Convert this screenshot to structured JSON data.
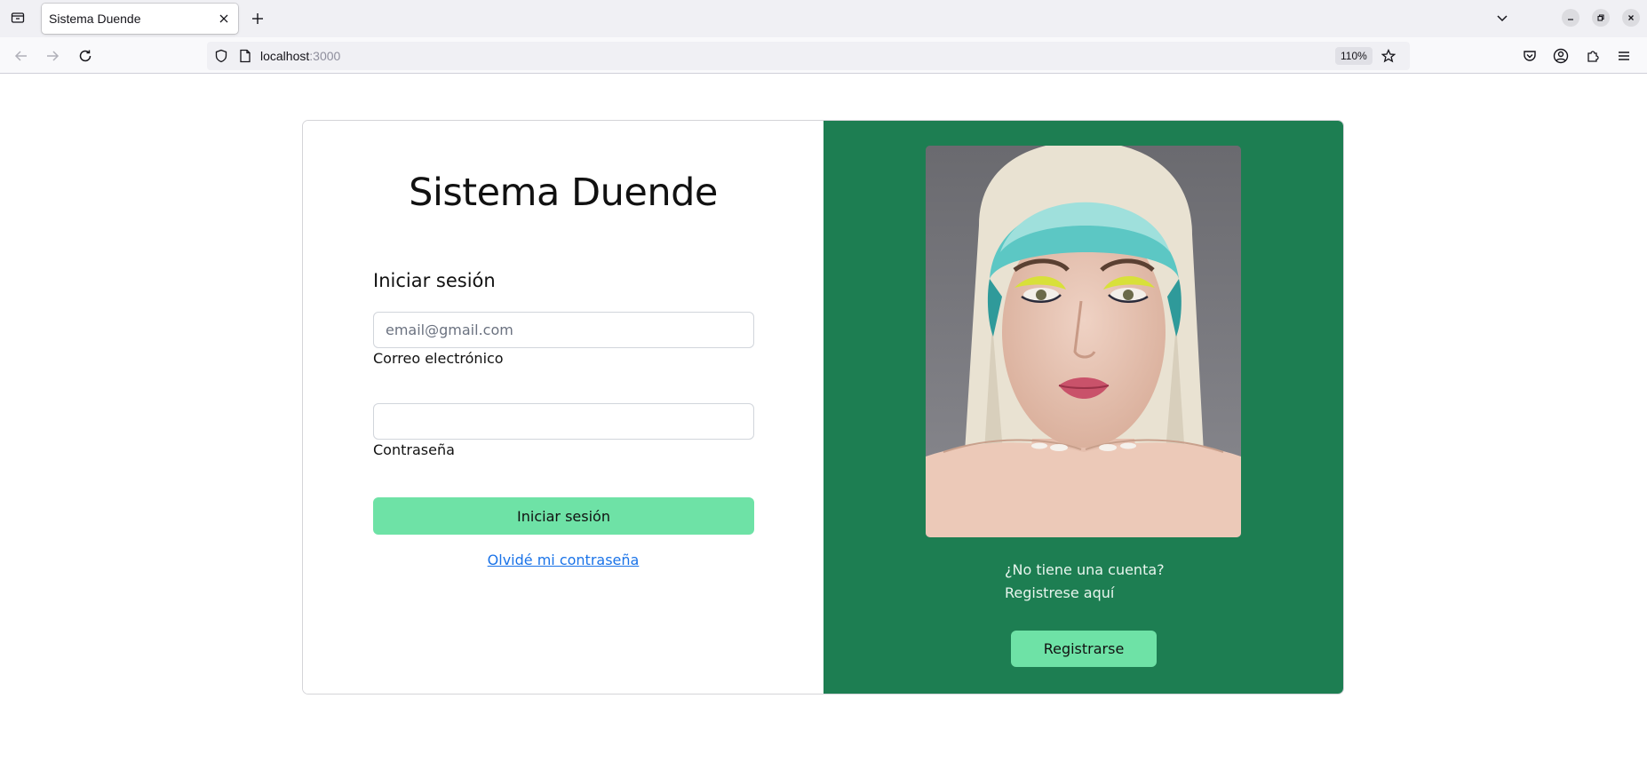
{
  "browser": {
    "tab_title": "Sistema Duende",
    "url_host": "localhost",
    "url_port": ":3000",
    "zoom_level": "110%"
  },
  "page": {
    "brand_title": "Sistema Duende",
    "login": {
      "heading": "Iniciar sesión",
      "email_placeholder": "email@gmail.com",
      "email_label": "Correo electrónico",
      "password_label": "Contraseña",
      "submit_label": "Iniciar sesión",
      "forgot_link": "Olvidé mi contraseña"
    },
    "signup": {
      "question": "¿No tiene una cuenta?",
      "hint": "Registrese aquí",
      "button_label": "Registrarse"
    }
  },
  "colors": {
    "accent_green": "#1d7e52",
    "button_green": "#6ee2a6",
    "link_blue": "#1a73e8"
  }
}
